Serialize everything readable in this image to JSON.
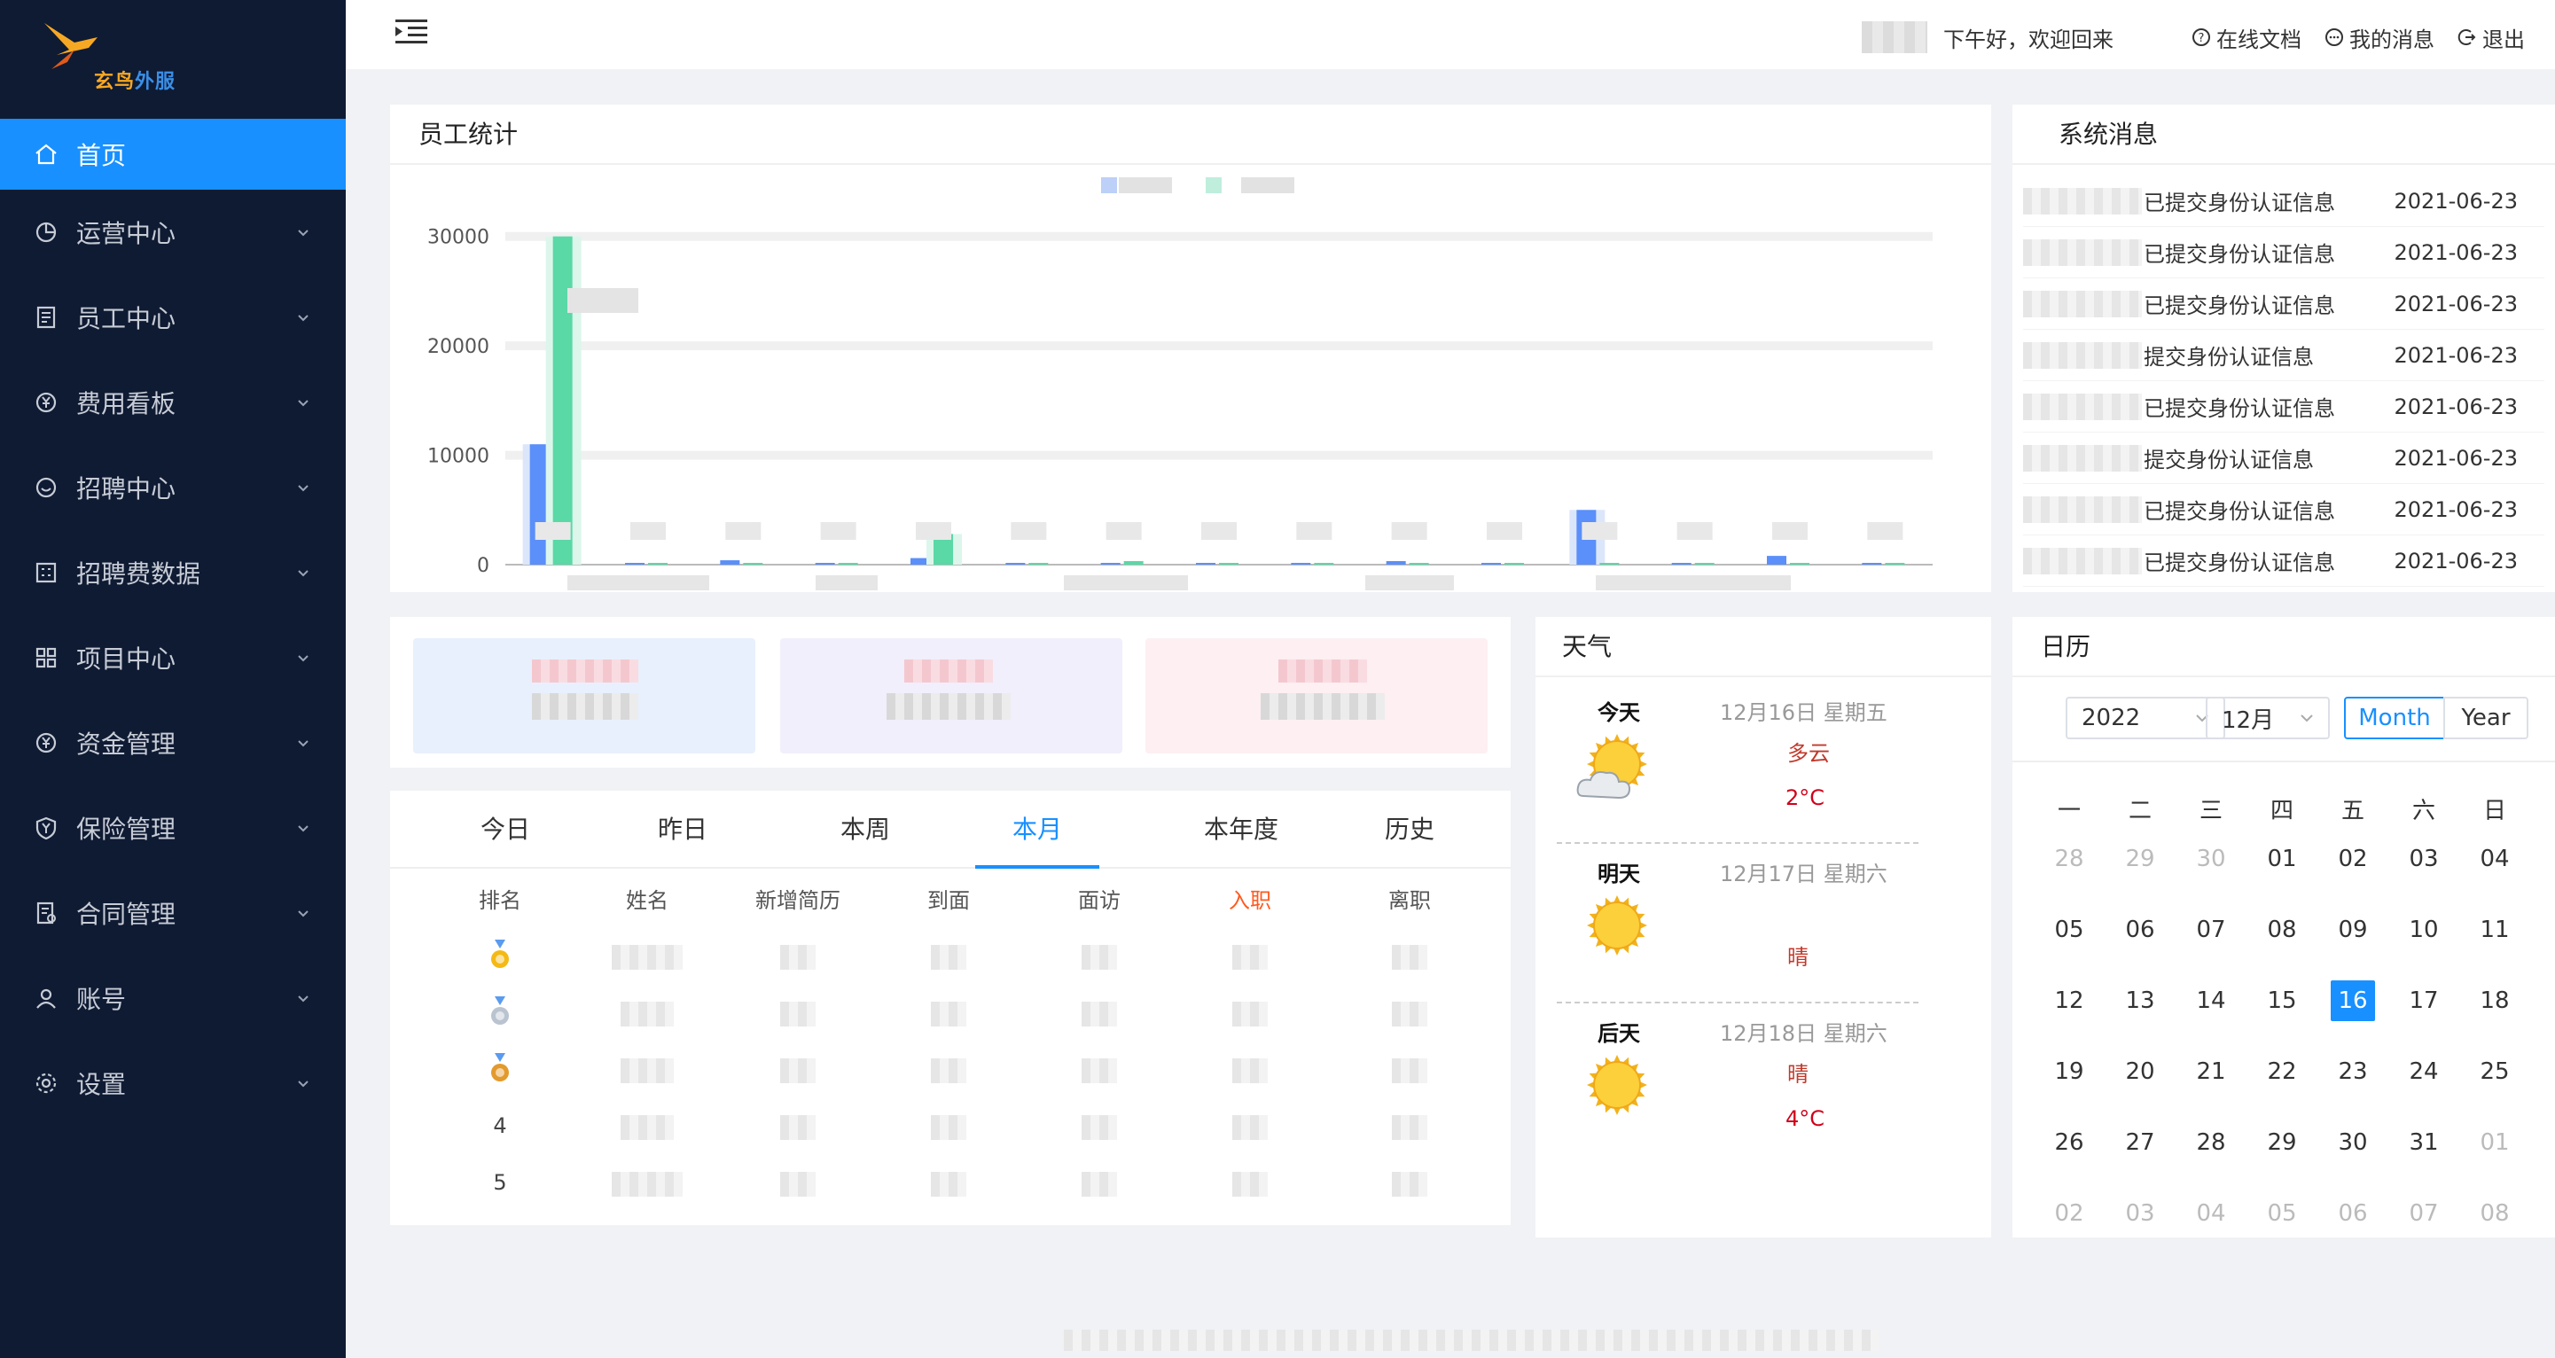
{
  "logo": {
    "text_a": "玄鸟",
    "text_b": "外服"
  },
  "sidebar": {
    "items": [
      {
        "label": "首页",
        "icon": "home-icon",
        "active": true
      },
      {
        "label": "运营中心",
        "icon": "pie-chart-icon"
      },
      {
        "label": "员工中心",
        "icon": "document-list-icon"
      },
      {
        "label": "费用看板",
        "icon": "yen-circle-icon"
      },
      {
        "label": "招聘中心",
        "icon": "smile-icon"
      },
      {
        "label": "招聘费数据",
        "icon": "calculator-icon"
      },
      {
        "label": "项目中心",
        "icon": "grid-icon"
      },
      {
        "label": "资金管理",
        "icon": "yen-circle-icon"
      },
      {
        "label": "保险管理",
        "icon": "shield-yen-icon"
      },
      {
        "label": "合同管理",
        "icon": "contract-icon"
      },
      {
        "label": "账号",
        "icon": "user-icon"
      },
      {
        "label": "设置",
        "icon": "gear-icon"
      }
    ]
  },
  "topbar": {
    "greeting": "下午好，欢迎回来",
    "docs": "在线文档",
    "messages": "我的消息",
    "logout": "退出"
  },
  "employee_stats": {
    "title": "员工统计",
    "chart_data": {
      "type": "bar",
      "yticks": [
        0,
        10000,
        20000,
        30000
      ],
      "ylim": [
        0,
        32000
      ],
      "categories_count": 15,
      "series": [
        {
          "color": "#5b8ff9",
          "values": [
            11000,
            0,
            400,
            0,
            600,
            0,
            0,
            0,
            0,
            300,
            0,
            5000,
            0,
            800,
            0
          ]
        },
        {
          "color": "#5ad8a6",
          "values": [
            30000,
            0,
            0,
            0,
            2800,
            0,
            200,
            0,
            0,
            0,
            0,
            0,
            0,
            0,
            0
          ]
        }
      ]
    }
  },
  "system_messages": {
    "title": "系统消息",
    "items": [
      {
        "text": "已提交身份认证信息",
        "date": "2021-06-23"
      },
      {
        "text": "已提交身份认证信息",
        "date": "2021-06-23"
      },
      {
        "text": "已提交身份认证信息",
        "date": "2021-06-23"
      },
      {
        "text": "提交身份认证信息",
        "date": "2021-06-23"
      },
      {
        "text": "已提交身份认证信息",
        "date": "2021-06-23"
      },
      {
        "text": "提交身份认证信息",
        "date": "2021-06-23"
      },
      {
        "text": "已提交身份认证信息",
        "date": "2021-06-23"
      },
      {
        "text": "已提交身份认证信息",
        "date": "2021-06-23"
      }
    ]
  },
  "ranking": {
    "tabs": [
      "今日",
      "昨日",
      "本周",
      "本月",
      "本年度",
      "历史"
    ],
    "active_tab": 3,
    "headers": [
      "排名",
      "姓名",
      "新增简历",
      "到面",
      "面访",
      "入职",
      "离职"
    ],
    "ranks": [
      "gold-medal-icon",
      "silver-medal-icon",
      "bronze-medal-icon",
      "4",
      "5"
    ]
  },
  "weather": {
    "title": "天气",
    "days": [
      {
        "label": "今天",
        "date": "12月16日  星期五",
        "cond": "多云",
        "temp": "2°C",
        "icon": "partly-cloudy-icon"
      },
      {
        "label": "明天",
        "date": "12月17日  星期六",
        "cond": "晴",
        "temp": "",
        "icon": "sun-icon"
      },
      {
        "label": "后天",
        "date": "12月18日  星期六",
        "cond": "晴",
        "temp": "4°C",
        "icon": "sun-icon"
      }
    ]
  },
  "calendar": {
    "title": "日历",
    "year": "2022",
    "month": "12月",
    "mode_month": "Month",
    "mode_year": "Year",
    "weekdays": [
      "一",
      "二",
      "三",
      "四",
      "五",
      "六",
      "日"
    ],
    "weeks": [
      [
        "28",
        "29",
        "30",
        "01",
        "02",
        "03",
        "04"
      ],
      [
        "05",
        "06",
        "07",
        "08",
        "09",
        "10",
        "11"
      ],
      [
        "12",
        "13",
        "14",
        "15",
        "16",
        "17",
        "18"
      ],
      [
        "19",
        "20",
        "21",
        "22",
        "23",
        "24",
        "25"
      ],
      [
        "26",
        "27",
        "28",
        "29",
        "30",
        "31",
        "01"
      ],
      [
        "02",
        "03",
        "04",
        "05",
        "06",
        "07",
        "08"
      ]
    ],
    "today": "16"
  },
  "colors": {
    "accent": "#1890ff",
    "sidebar": "#0f1b33",
    "green": "#5ad8a6",
    "blue": "#5b8ff9"
  }
}
